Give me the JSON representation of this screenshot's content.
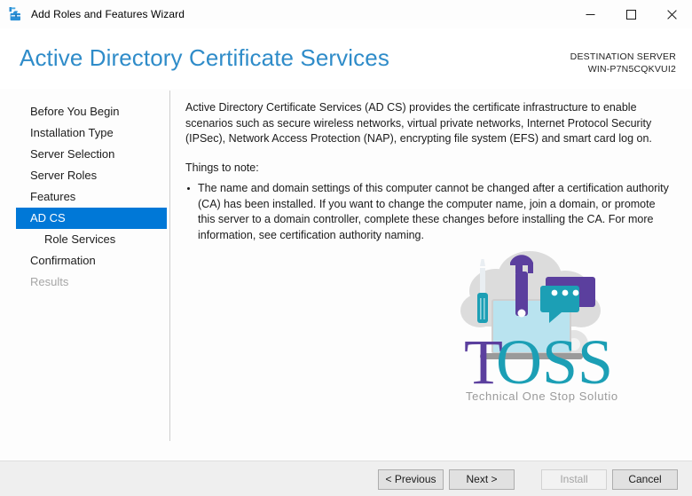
{
  "window": {
    "title": "Add Roles and Features Wizard",
    "app_icon": "server-manager-toolbox-icon",
    "controls": {
      "minimize": "minimize-icon",
      "maximize": "maximize-icon",
      "close": "close-icon"
    }
  },
  "header": {
    "page_title": "Active Directory Certificate Services",
    "destination_label": "DESTINATION SERVER",
    "destination_server": "WIN-P7N5CQKVUI2",
    "title_color": "#2f8cc9"
  },
  "nav": {
    "selected_index": 5,
    "accent_color": "#0078d7",
    "items": [
      {
        "label": "Before You Begin",
        "state": "normal",
        "indent": false
      },
      {
        "label": "Installation Type",
        "state": "normal",
        "indent": false
      },
      {
        "label": "Server Selection",
        "state": "normal",
        "indent": false
      },
      {
        "label": "Server Roles",
        "state": "normal",
        "indent": false
      },
      {
        "label": "Features",
        "state": "normal",
        "indent": false
      },
      {
        "label": "AD CS",
        "state": "selected",
        "indent": false
      },
      {
        "label": "Role Services",
        "state": "normal",
        "indent": true
      },
      {
        "label": "Confirmation",
        "state": "normal",
        "indent": false
      },
      {
        "label": "Results",
        "state": "disabled",
        "indent": false
      }
    ]
  },
  "content": {
    "intro_paragraph": "Active Directory Certificate Services (AD CS) provides the certificate infrastructure to enable scenarios such as secure wireless networks, virtual private networks, Internet Protocol Security (IPSec), Network Access Protection (NAP), encrypting file system (EFS) and smart card log on.",
    "notes_heading": "Things to note:",
    "notes": [
      "The name and domain settings of this computer cannot be changed after a certification authority (CA) has been installed. If you want to change the computer name, join a domain, or promote this server to a domain controller, complete these changes before installing the CA. For more information, see certification authority naming."
    ]
  },
  "watermark": {
    "name": "toss-logo-watermark",
    "brand_t": "T",
    "brand_oss": "OSS",
    "tagline": "Technical One Stop Solution",
    "colors": {
      "purple": "#5b3f9e",
      "teal": "#1c9fb5",
      "cloud": "#dcdcdc",
      "screen": "#b9e3ef",
      "laptop_base": "#9a9a9a"
    }
  },
  "footer": {
    "buttons": [
      {
        "label": "< Previous",
        "name": "previous-button",
        "disabled": false
      },
      {
        "label": "Next >",
        "name": "next-button",
        "disabled": false
      },
      {
        "label": "Install",
        "name": "install-button",
        "disabled": true
      },
      {
        "label": "Cancel",
        "name": "cancel-button",
        "disabled": false
      }
    ]
  }
}
